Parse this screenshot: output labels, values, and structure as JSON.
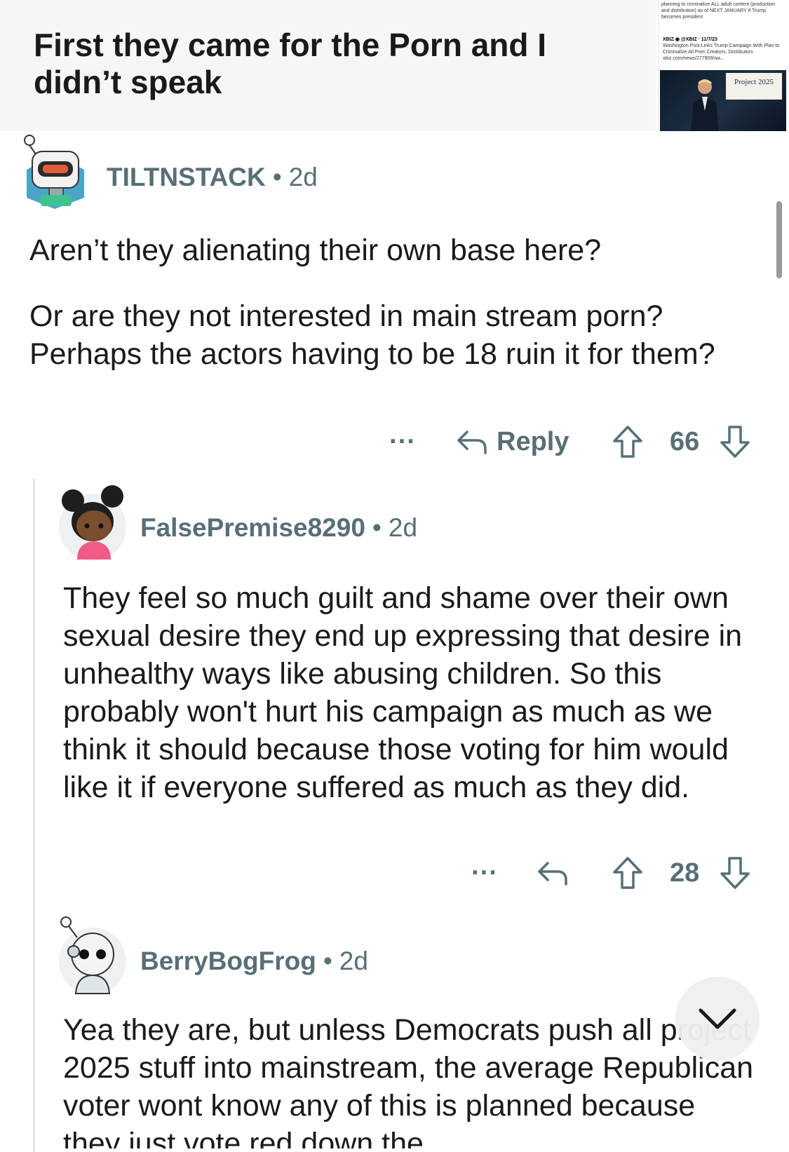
{
  "post": {
    "title": "First they came for the Porn and I didn’t speak",
    "thumbnail": {
      "caption_top": "planning to criminalize ALL adult content (production and distribution) as of NEXT JANUARY if Trump becomes president",
      "tweet_account": "XBIZ ◉ @XBIZ · 11/7/23",
      "tweet_text": "Washington Post Links Trump Campaign With Plan to Criminalize All Porn Creators, Distributors xbiz.com/news/277909/wa...",
      "badge": "Project 2025"
    }
  },
  "comments": [
    {
      "username": "TILTNSTACK",
      "age": "2d",
      "paragraphs": [
        "Aren’t they alienating their own base here?",
        "Or are they not interested in main stream porn? Perhaps the actors having to be 18 ruin it for them?"
      ],
      "more": "···",
      "reply_label": "Reply",
      "score": "66"
    },
    {
      "username": "FalsePremise8290",
      "age": "2d",
      "paragraphs": [
        "They feel so much guilt and shame over their own sexual desire they end up expressing that desire in unhealthy ways like abusing children. So this probably won't hurt his campaign as much as we think it should because those voting for him would like it if everyone suffered as much as they did."
      ],
      "more": "···",
      "score": "28"
    },
    {
      "username": "BerryBogFrog",
      "age": "2d",
      "paragraphs": [
        "Yea they are, but unless Democrats push all project 2025 stuff into mainstream, the average Republican voter wont know any of this is planned because they just vote red down the"
      ]
    }
  ],
  "colors": {
    "meta": "#576f76",
    "text": "#1a1a1b",
    "header_bg": "#f6f6f7",
    "thread_line": "#e1e4e6"
  },
  "icons": [
    "robot-avatar-icon",
    "girl-avatar-icon",
    "astronaut-avatar-icon",
    "reply-arrow-icon",
    "upvote-icon",
    "downvote-icon",
    "more-dots-icon",
    "chevron-down-icon"
  ]
}
